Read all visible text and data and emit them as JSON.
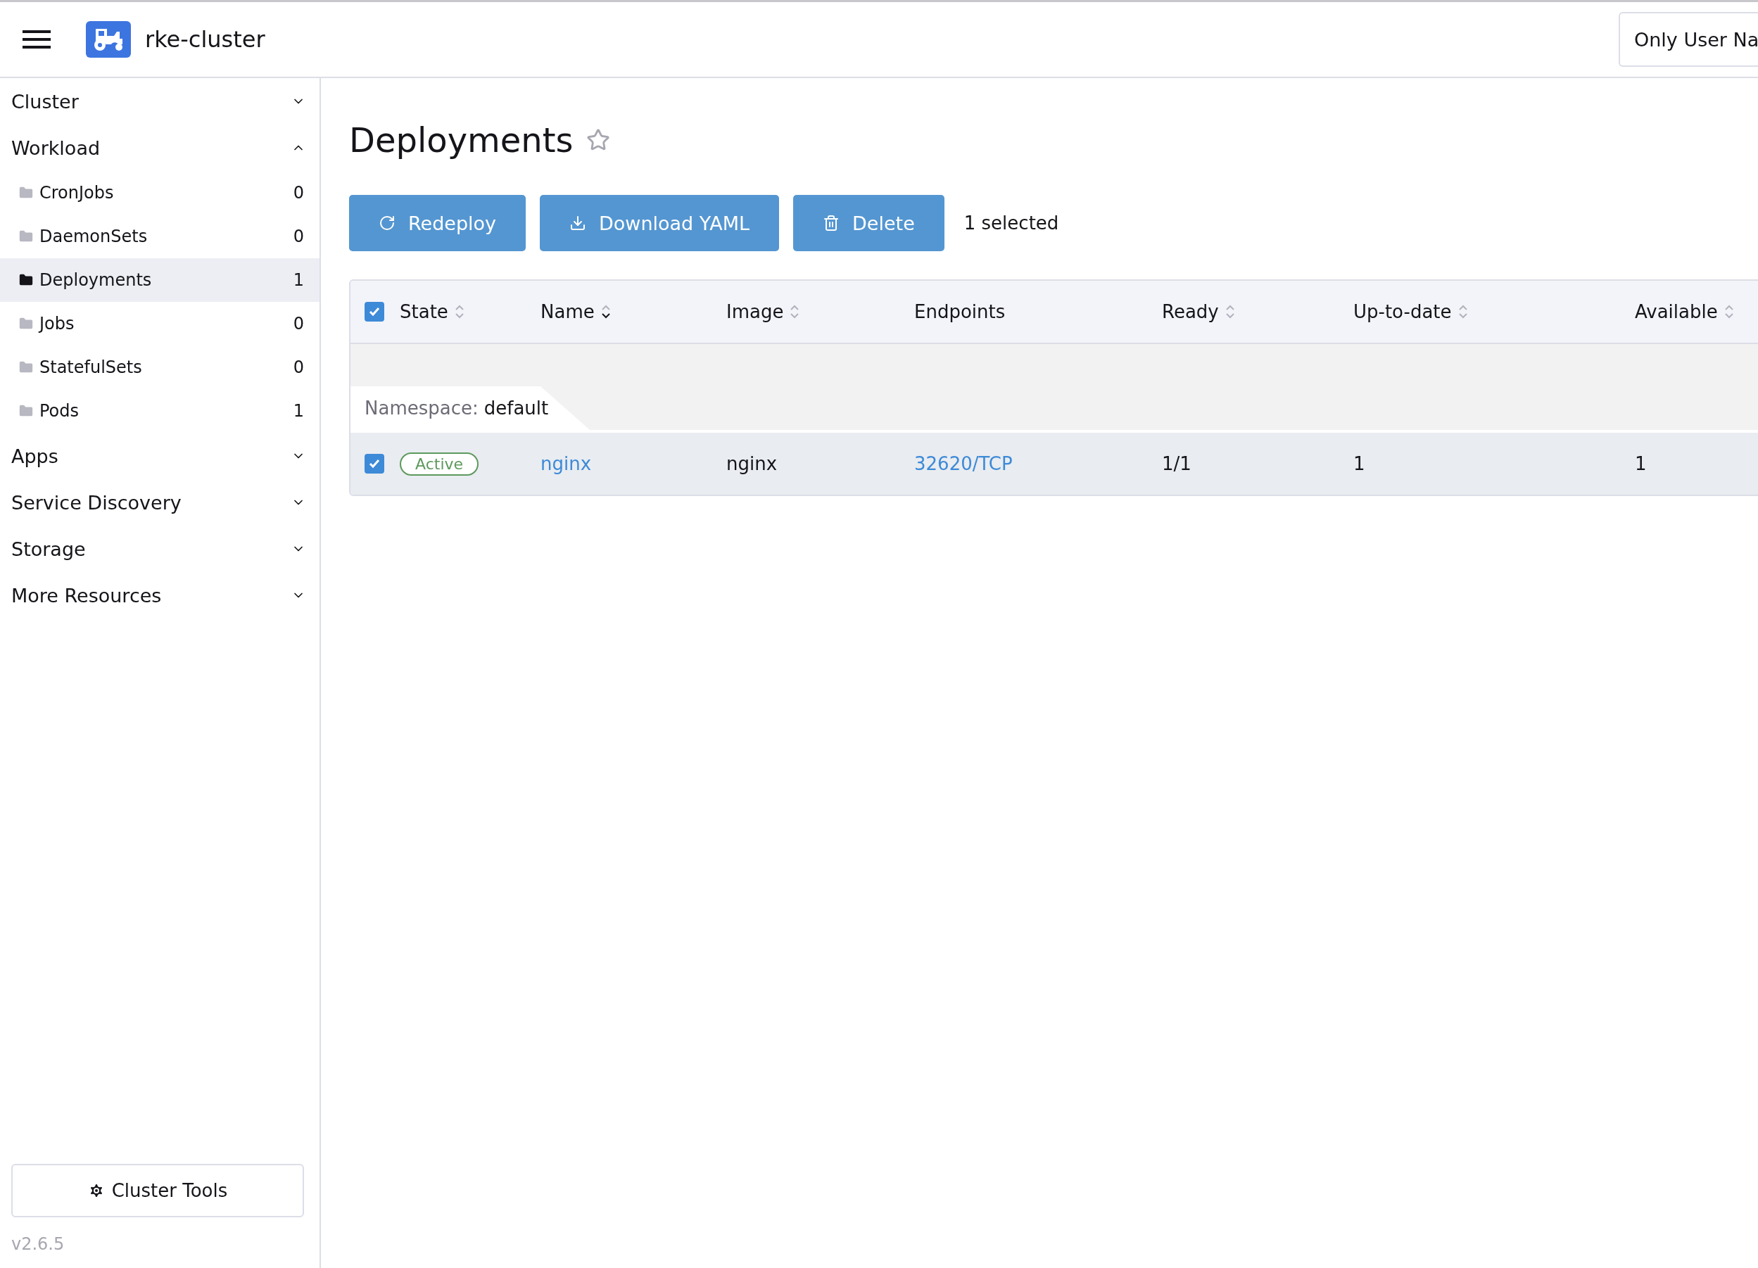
{
  "header": {
    "cluster_name": "rke-cluster",
    "namespace_filter": "Only User Na"
  },
  "sidebar": {
    "groups": [
      {
        "label": "Cluster",
        "expanded": false
      },
      {
        "label": "Workload",
        "expanded": true,
        "items": [
          {
            "label": "CronJobs",
            "count": "0",
            "selected": false
          },
          {
            "label": "DaemonSets",
            "count": "0",
            "selected": false
          },
          {
            "label": "Deployments",
            "count": "1",
            "selected": true
          },
          {
            "label": "Jobs",
            "count": "0",
            "selected": false
          },
          {
            "label": "StatefulSets",
            "count": "0",
            "selected": false
          },
          {
            "label": "Pods",
            "count": "1",
            "selected": false
          }
        ]
      },
      {
        "label": "Apps",
        "expanded": false
      },
      {
        "label": "Service Discovery",
        "expanded": false
      },
      {
        "label": "Storage",
        "expanded": false
      },
      {
        "label": "More Resources",
        "expanded": false
      }
    ],
    "tools_button": "Cluster Tools",
    "version": "v2.6.5"
  },
  "page": {
    "title": "Deployments",
    "favorite": false
  },
  "actions": [
    {
      "kind": "redeploy",
      "label": "Redeploy"
    },
    {
      "kind": "download",
      "label": "Download YAML"
    },
    {
      "kind": "delete",
      "label": "Delete"
    }
  ],
  "selection_count": "1 selected",
  "table": {
    "all_checked": true,
    "columns": [
      {
        "label": "State",
        "sortable": true,
        "sorted": false
      },
      {
        "label": "Name",
        "sortable": true,
        "sorted": true
      },
      {
        "label": "Image",
        "sortable": true,
        "sorted": false
      },
      {
        "label": "Endpoints",
        "sortable": false,
        "sorted": false
      },
      {
        "label": "Ready",
        "sortable": true,
        "sorted": false
      },
      {
        "label": "Up-to-date",
        "sortable": true,
        "sorted": false
      },
      {
        "label": "Available",
        "sortable": true,
        "sorted": false
      }
    ],
    "groups": [
      {
        "label": "Namespace:",
        "value": "default",
        "rows": [
          {
            "checked": true,
            "state": "Active",
            "name": "nginx",
            "image": "nginx",
            "endpoints": "32620/TCP",
            "ready": "1/1",
            "up_to_date": "1",
            "available": "1"
          }
        ]
      }
    ]
  }
}
